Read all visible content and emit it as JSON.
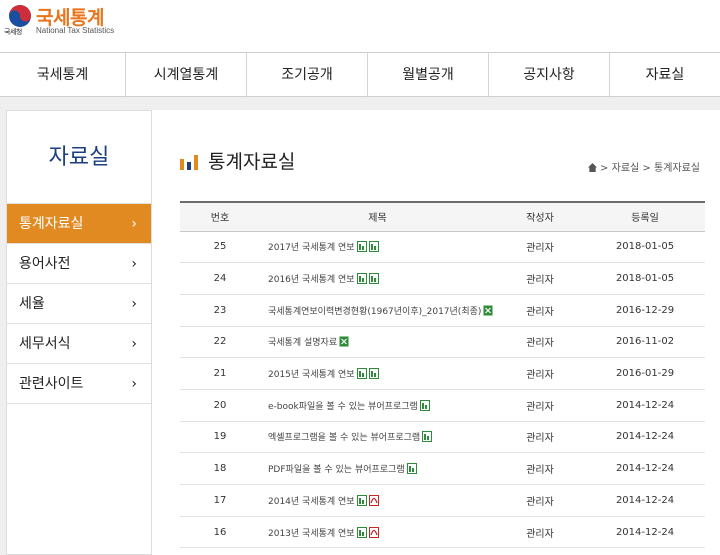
{
  "header": {
    "logo_emblem_text": "국세청",
    "title": "국세통계",
    "subtitle": "National Tax Statistics"
  },
  "nav": [
    "국세통계",
    "시계열통계",
    "조기공개",
    "월별공개",
    "공지사항",
    "자료실"
  ],
  "sidebar": {
    "title": "자료실",
    "items": [
      {
        "label": "통계자료실",
        "active": true
      },
      {
        "label": "용어사전",
        "active": false
      },
      {
        "label": "세율",
        "active": false
      },
      {
        "label": "세무서식",
        "active": false
      },
      {
        "label": "관련사이트",
        "active": false
      }
    ]
  },
  "main": {
    "title": "통계자료실",
    "breadcrumb": {
      "sep": ">",
      "parent": "자료실",
      "current": "통계자료실"
    }
  },
  "table": {
    "headers": [
      "번호",
      "제목",
      "작성자",
      "등록일"
    ],
    "rows": [
      {
        "no": "25",
        "title": "2017년 국세통계 연보",
        "icons": [
          "excel",
          "excel"
        ],
        "author": "관리자",
        "date": "2018-01-05"
      },
      {
        "no": "24",
        "title": "2016년 국세통계 연보",
        "icons": [
          "excel",
          "excel"
        ],
        "author": "관리자",
        "date": "2018-01-05"
      },
      {
        "no": "23",
        "title": "국세통계연보이력변경현황(1967년이후)_2017년(최종)",
        "icons": [
          "xls"
        ],
        "author": "관리자",
        "date": "2016-12-29"
      },
      {
        "no": "22",
        "title": "국세통계 설명자료",
        "icons": [
          "xls"
        ],
        "author": "관리자",
        "date": "2016-11-02"
      },
      {
        "no": "21",
        "title": "2015년 국세통계 연보",
        "icons": [
          "excel",
          "excel"
        ],
        "author": "관리자",
        "date": "2016-01-29"
      },
      {
        "no": "20",
        "title": "e-book파일을 볼 수 있는 뷰어프로그램",
        "icons": [
          "excel"
        ],
        "author": "관리자",
        "date": "2014-12-24"
      },
      {
        "no": "19",
        "title": "엑셀프로그램을 볼 수 있는 뷰어프로그램",
        "icons": [
          "excel"
        ],
        "author": "관리자",
        "date": "2014-12-24"
      },
      {
        "no": "18",
        "title": "PDF파일을 볼 수 있는 뷰어프로그램",
        "icons": [
          "excel"
        ],
        "author": "관리자",
        "date": "2014-12-24"
      },
      {
        "no": "17",
        "title": "2014년 국세통계 연보",
        "icons": [
          "excel",
          "pdf"
        ],
        "author": "관리자",
        "date": "2014-12-24"
      },
      {
        "no": "16",
        "title": "2013년 국세통계 연보",
        "icons": [
          "excel",
          "pdf"
        ],
        "author": "관리자",
        "date": "2014-12-24"
      }
    ]
  },
  "colors": {
    "accent": "#e28a22",
    "logo": "#e8741b",
    "sidebar_title": "#1c3f7f",
    "excel": "#2e8b3a",
    "pdf": "#c62828"
  }
}
